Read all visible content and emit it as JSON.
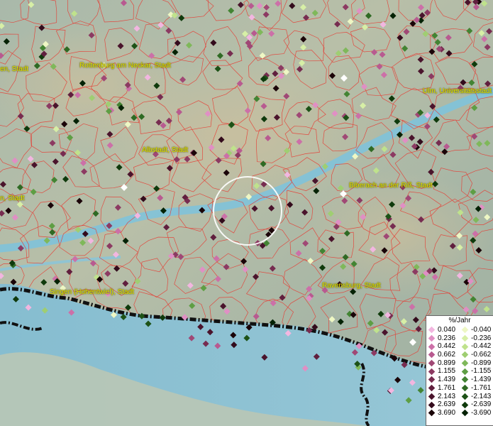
{
  "map": {
    "cities": [
      {
        "name": "Rottenburg am Neckar, Stadt",
        "id": "rottenburg"
      },
      {
        "name": "Ulm, Universitätsstadt",
        "id": "ulm"
      },
      {
        "name": "Albstadt, Stadt",
        "id": "albstadt"
      },
      {
        "name": "Biberach an der Riß, Stadt",
        "id": "biberach"
      },
      {
        "name": "Singen (Hohentwiel), Stadt",
        "id": "singen"
      },
      {
        "name": "Ravensburg, Stadt",
        "id": "ravensburg"
      },
      {
        "name": "en, Stadt",
        "id": "left-top"
      },
      {
        "name": "n, Stadt",
        "id": "left-mid"
      }
    ]
  },
  "legend": {
    "title": "%/Jahr",
    "positive": [
      {
        "label": "0.040",
        "color": "#f2b6e0"
      },
      {
        "label": "0.236",
        "color": "#e08fc4"
      },
      {
        "label": "0.442",
        "color": "#cc70a8"
      },
      {
        "label": "0.662",
        "color": "#b85a90"
      },
      {
        "label": "0.899",
        "color": "#a04875"
      },
      {
        "label": "1.155",
        "color": "#8c3a62"
      },
      {
        "label": "1.439",
        "color": "#772c50"
      },
      {
        "label": "1.761",
        "color": "#601f3e"
      },
      {
        "label": "2.143",
        "color": "#4a142c"
      },
      {
        "label": "2.639",
        "color": "#330b1c"
      },
      {
        "label": "3.690",
        "color": "#1a0408"
      }
    ],
    "negative": [
      {
        "label": "-0.040",
        "color": "#eef7c4"
      },
      {
        "label": "-0.236",
        "color": "#d7efa6"
      },
      {
        "label": "-0.442",
        "color": "#bfe28c"
      },
      {
        "label": "-0.662",
        "color": "#9fce72"
      },
      {
        "label": "-0.899",
        "color": "#7fb85a"
      },
      {
        "label": "-1.155",
        "color": "#5e9e44"
      },
      {
        "label": "-1.439",
        "color": "#438433"
      },
      {
        "label": "-1.761",
        "color": "#2f6a24"
      },
      {
        "label": "-2.143",
        "color": "#1d5217"
      },
      {
        "label": "-2.639",
        "color": "#0f3a0c"
      },
      {
        "label": "-3.690",
        "color": "#052205"
      }
    ]
  }
}
